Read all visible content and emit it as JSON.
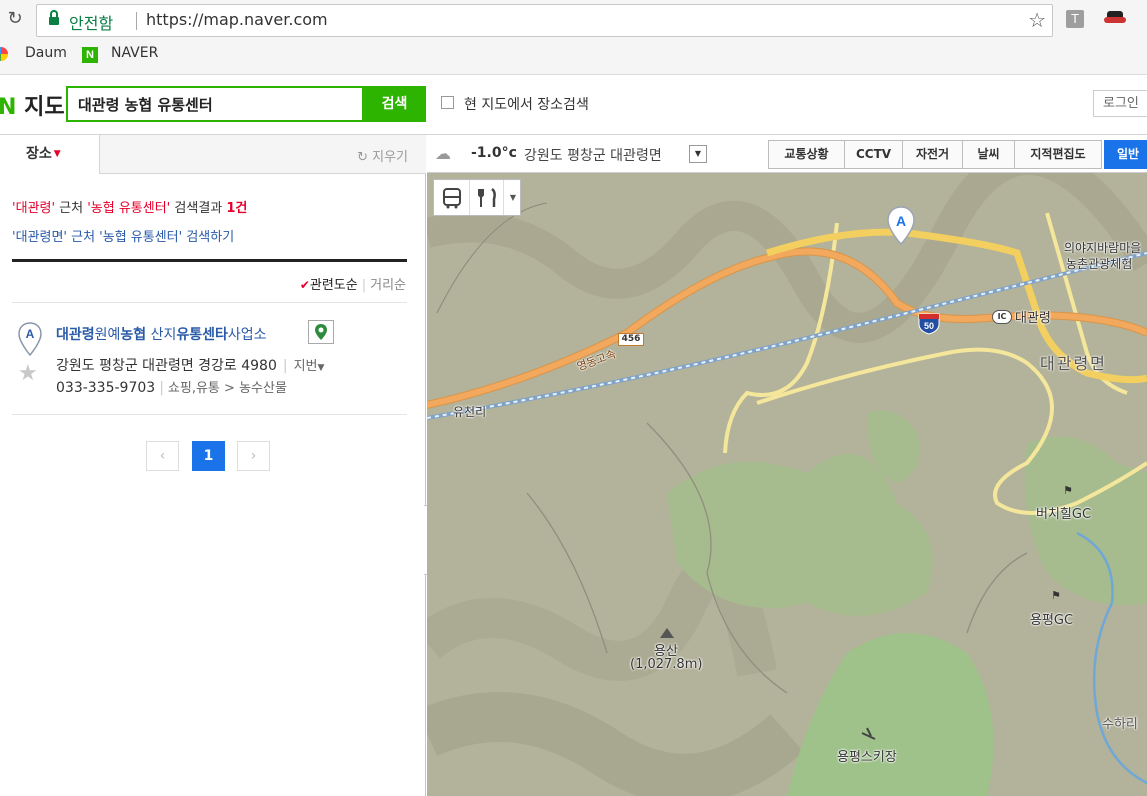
{
  "browser": {
    "secure_label": "안전함",
    "url": "https://map.naver.com",
    "ext1_label": "T",
    "bookmarks": [
      "Daum",
      "NAVER"
    ],
    "naver_icon_letter": "N"
  },
  "header": {
    "logo_n": "N",
    "logo_text": "지도",
    "search_value": "대관령 농협 유통센터",
    "search_button": "검색",
    "checkbox_label": "현 지도에서 장소검색",
    "login": "로그인"
  },
  "panel": {
    "tab_place": "장소",
    "clear": "지우기",
    "summary": {
      "q1": "'대관령'",
      "near": " 근처 ",
      "q2": "'농협 유통센터'",
      "result_label": " 검색결과 ",
      "count": "1건"
    },
    "suggest": "'대관령면' 근처 '농협 유통센터' 검색하기",
    "sort": {
      "relevance": "관련도순",
      "distance": "거리순"
    },
    "result": {
      "marker": "A",
      "title_parts": [
        "대관령",
        "원예",
        "농협",
        " 산지",
        "유통센타",
        "사업소"
      ],
      "address": "강원도 평창군 대관령면 경강로 4980",
      "lot_label": "지번",
      "phone": "033-335-9703",
      "category_1": "쇼핑,유통",
      "category_2": "농수산물"
    },
    "pagination": {
      "prev": "‹",
      "current": "1",
      "next": "›"
    }
  },
  "mapbar": {
    "temperature": "-1.0°c",
    "region": "강원도 평창군 대관령면",
    "buttons": [
      "교통상황",
      "CCTV",
      "자전거",
      "날씨",
      "지적편집도",
      "일반"
    ]
  },
  "map": {
    "marker": "A",
    "labels": {
      "road_number": "456",
      "expressway": "영동고속",
      "highway_shield": "50",
      "ic_badge": "IC",
      "ic_name": "대관령",
      "village": "의야지바람마을",
      "village_2": "농촌관광체험",
      "town": "대관령면",
      "yucheon": "유천리",
      "birch_gc": "버치힐GC",
      "yongpyong_gc": "용평GC",
      "mountain": "용산",
      "mountain_height": "(1,027.8m)",
      "ski": "용평스키장",
      "suhari": "수하리"
    }
  }
}
